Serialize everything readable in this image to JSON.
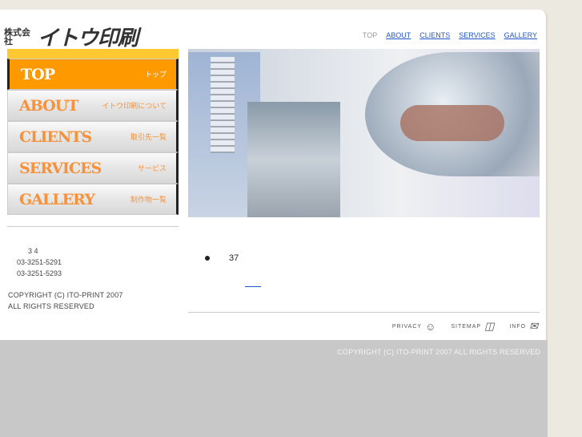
{
  "logo": {
    "small": "株式会社",
    "big": "イトウ印刷"
  },
  "topnav": [
    {
      "label": "TOP"
    },
    {
      "label": "ABOUT"
    },
    {
      "label": "CLIENTS"
    },
    {
      "label": "SERVICES"
    },
    {
      "label": "GALLERY"
    }
  ],
  "menu": [
    {
      "en": "TOP",
      "jp": "トップ"
    },
    {
      "en": "ABOUT",
      "jp": "イトウ印刷について"
    },
    {
      "en": "CLIENTS",
      "jp": "取引先一覧"
    },
    {
      "en": "SERVICES",
      "jp": "サービス"
    },
    {
      "en": "GALLERY",
      "jp": "制作物一覧"
    }
  ],
  "address": {
    "line1": "3 4",
    "tel": "03-3251-5291",
    "fax": "03-3251-5293"
  },
  "side_copyright": {
    "line1": "COPYRIGHT (C) ITO-PRINT 2007",
    "line2": "ALL RIGHTS RESERVED"
  },
  "news": {
    "text": "37"
  },
  "util": {
    "privacy": "PRIVACY",
    "sitemap": "SITEMAP",
    "info": "INFO"
  },
  "footer": {
    "copyright": "COPYRIGHT (C) ITO-PRINT 2007 ALL RIGHTS RESERVED"
  }
}
